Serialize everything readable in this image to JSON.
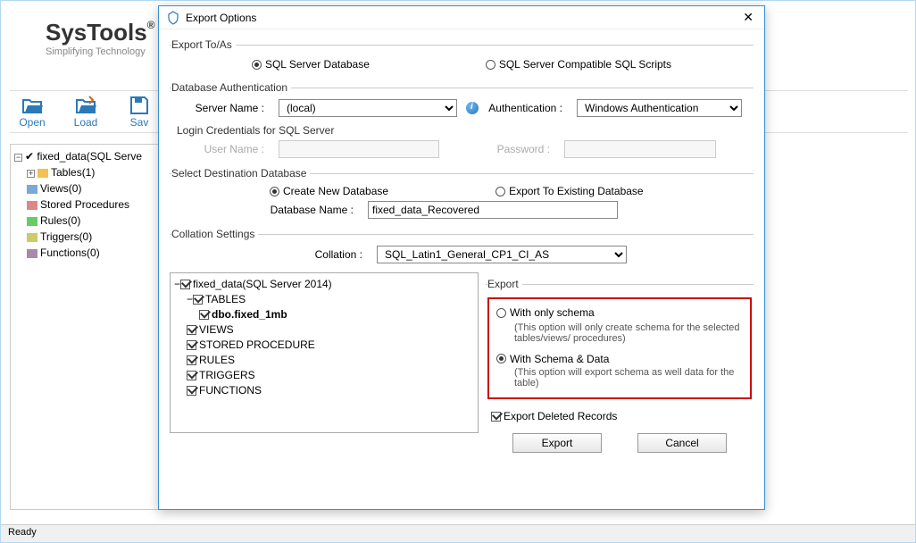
{
  "brand": {
    "name": "SysTools",
    "tagline": "Simplifying Technology"
  },
  "toolbar": {
    "open": "Open",
    "load": "Load",
    "save": "Sav"
  },
  "sidebar": {
    "root": "fixed_data(SQL Serve",
    "items": [
      "Tables(1)",
      "Views(0)",
      "Stored Procedures",
      "Rules(0)",
      "Triggers(0)",
      "Functions(0)"
    ]
  },
  "status": "Ready",
  "dialog": {
    "title": "Export Options",
    "exportToAs": {
      "legend": "Export To/As",
      "opt1": "SQL Server Database",
      "opt2": "SQL Server Compatible SQL Scripts"
    },
    "dbauth": {
      "legend": "Database Authentication",
      "serverNameLbl": "Server Name :",
      "serverName": "(local)",
      "authLbl": "Authentication :",
      "authValue": "Windows Authentication",
      "credsLegend": "Login Credentials for SQL Server",
      "userLbl": "User Name :",
      "passLbl": "Password :"
    },
    "dest": {
      "legend": "Select Destination Database",
      "opt1": "Create New Database",
      "opt2": "Export To Existing Database",
      "dbNameLbl": "Database Name :",
      "dbName": "fixed_data_Recovered"
    },
    "collation": {
      "legend": "Collation Settings",
      "lbl": "Collation :",
      "value": "SQL_Latin1_General_CP1_CI_AS"
    },
    "tree": {
      "root": "fixed_data(SQL Server 2014)",
      "nodes": [
        "TABLES",
        "VIEWS",
        "STORED PROCEDURE",
        "RULES",
        "TRIGGERS",
        "FUNCTIONS"
      ],
      "tableChild": "dbo.fixed_1mb"
    },
    "export": {
      "legend": "Export",
      "opt1": "With only schema",
      "opt1desc": "(This option will only create schema for the  selected tables/views/ procedures)",
      "opt2": "With Schema & Data",
      "opt2desc": "(This option will export schema as well data for the table)",
      "deleted": "Export Deleted Records"
    },
    "buttons": {
      "export": "Export",
      "cancel": "Cancel"
    }
  }
}
